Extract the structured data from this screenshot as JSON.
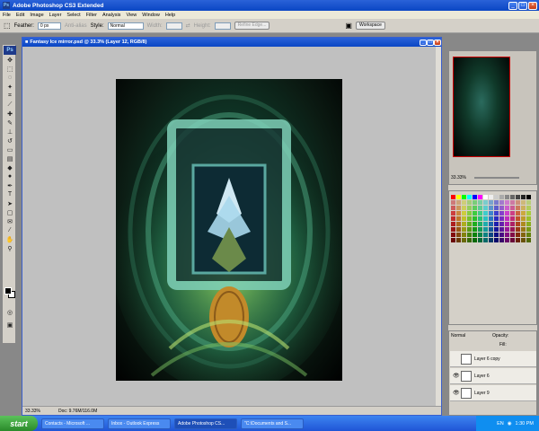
{
  "window": {
    "title": "Adobe Photoshop CS3 Extended",
    "app_icon": "Ps"
  },
  "menu": [
    "File",
    "Edit",
    "Image",
    "Layer",
    "Select",
    "Filter",
    "Analysis",
    "View",
    "Window",
    "Help"
  ],
  "options": {
    "feather_label": "Feather:",
    "feather_value": "0 px",
    "antialias_label": "Anti-alias",
    "style_label": "Style:",
    "style_value": "Normal",
    "width_label": "Width:",
    "height_label": "Height:",
    "refine_edge": "Refine Edge...",
    "workspace": "Workspace"
  },
  "document": {
    "title": "Fantasy Ice mirror.psd @ 33.3% (Layer 12, RGB/8)",
    "zoom": "33.33%",
    "doc_info": "Doc: 9.76M/116.0M"
  },
  "navigator": {
    "zoom": "33.33%"
  },
  "layers": {
    "blend_mode": "Normal",
    "opacity_label": "Opacity:",
    "fill_label": "Fill:",
    "items": [
      {
        "name": "Layer 6 copy"
      },
      {
        "name": "Layer 6"
      },
      {
        "name": "Layer 9"
      }
    ]
  },
  "taskbar": {
    "start": "start",
    "tasks": [
      "Contacts - Microsoft ...",
      "Inbox - Outlook Express",
      "Adobe Photoshop CS...",
      "\"C:\\Documents and S..."
    ],
    "lang": "EN",
    "clock": "1:30 PM"
  },
  "colors": {
    "accent": "#0a46c4",
    "swatches": [
      "#ff0000",
      "#ffff00",
      "#00ff00",
      "#00ffff",
      "#0000ff",
      "#ff00ff",
      "#ffffff",
      "#eeeeee",
      "#cccccc",
      "#aaaaaa",
      "#888888",
      "#666666",
      "#444444",
      "#222222",
      "#000000"
    ]
  }
}
